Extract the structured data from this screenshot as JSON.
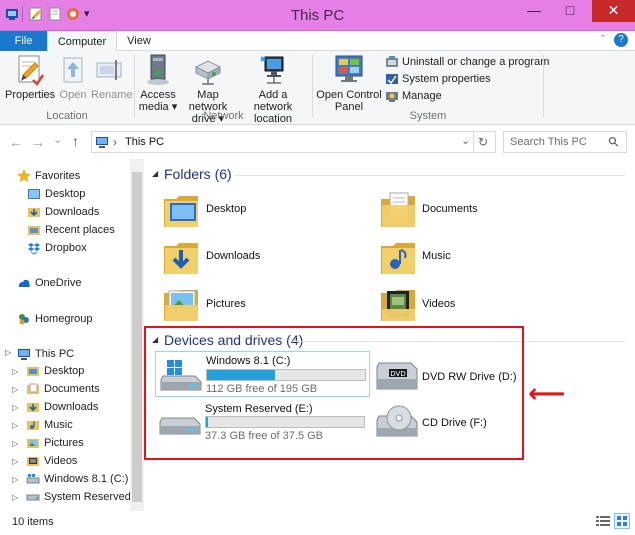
{
  "window": {
    "title": "This PC",
    "minimize_glyph": "—",
    "maximize_glyph": "□",
    "close_glyph": "✕"
  },
  "quick_access": {
    "dropdown_glyph": "▾"
  },
  "ribbon": {
    "tabs": [
      "File",
      "Computer",
      "View"
    ],
    "help_glyph": "?",
    "collapse_glyph": "ˆ",
    "groups": {
      "location": {
        "label": "Location",
        "buttons": [
          "Properties",
          "Open",
          "Rename"
        ]
      },
      "network": {
        "label": "Network",
        "access_media": [
          "Access",
          "media ▾"
        ],
        "map_network_drive": [
          "Map network",
          "drive ▾"
        ],
        "add_network_location": [
          "Add a network",
          "location"
        ]
      },
      "system": {
        "label": "System",
        "control_panel": [
          "Open Control",
          "Panel"
        ],
        "small_buttons": [
          "Uninstall or change a program",
          "System properties",
          "Manage"
        ]
      }
    }
  },
  "address_bar": {
    "back_glyph": "←",
    "forward_glyph": "→",
    "history_glyph": "⌄",
    "up_glyph": "↑",
    "breadcrumb_separator": "›",
    "path": "This PC",
    "dropdown_glyph": "⌄",
    "refresh_glyph": "↻",
    "search_placeholder": "Search This PC",
    "search_glyph": "⚲"
  },
  "nav_pane": {
    "favorites_label": "Favorites",
    "favorites": [
      "Desktop",
      "Downloads",
      "Recent places",
      "Dropbox"
    ],
    "onedrive_label": "OneDrive",
    "homegroup_label": "Homegroup",
    "this_pc_label": "This PC",
    "expand_glyph": "▷",
    "this_pc_items": [
      "Desktop",
      "Documents",
      "Downloads",
      "Music",
      "Pictures",
      "Videos",
      "Windows 8.1 (C:)",
      "System Reserved (E"
    ]
  },
  "content": {
    "folders_header": "Folders",
    "folders_count": "(6)",
    "section_toggle_glyph": "◢",
    "folders": [
      "Desktop",
      "Documents",
      "Downloads",
      "Music",
      "Pictures",
      "Videos"
    ],
    "devices_header": "Devices and drives",
    "devices_count": "(4)",
    "drives": [
      {
        "name": "Windows 8.1 (C:)",
        "free": "112 GB free of 195 GB",
        "used_fraction": 0.43
      },
      {
        "name": "DVD RW Drive (D:)"
      },
      {
        "name": "System Reserved (E:)",
        "free": "37.3 GB free of 37.5 GB",
        "used_fraction": 0.01
      },
      {
        "name": "CD Drive (F:)"
      }
    ],
    "annotation_arrow_glyph": "⟵"
  },
  "status": {
    "item_count": "10 items"
  },
  "colors": {
    "titlebar": "#e47fe6",
    "file_tab": "#1979ca",
    "close_button": "#c7292b",
    "annotation": "#e0141b",
    "progress_fill": "#26a0da",
    "section_header": "#1e3287"
  }
}
